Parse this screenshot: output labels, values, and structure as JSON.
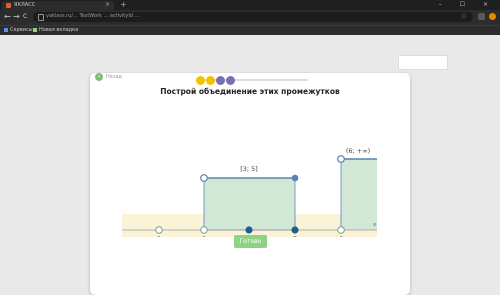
{
  "browser": {
    "tab_title": "ЯКЛАСС",
    "tab_close": "×",
    "new_tab": "+",
    "window_controls": "– ☐ ×",
    "back": "←",
    "forward": "→",
    "reload": "C",
    "url": "yaklass.ru/... TestWork ... activityId ...",
    "star_icon": "star-icon",
    "bookmarks": [
      {
        "label": "Сервисы",
        "icon": "grid-icon",
        "color": "#5b8def"
      },
      {
        "label": "Новая вкладка",
        "icon": "page-icon",
        "color": "#9bcf7e"
      }
    ]
  },
  "exercise": {
    "back_label": "Назад",
    "progress_dots": [
      "#f2c200",
      "#f2c200",
      "#7a6fb3",
      "#7a6fb3"
    ],
    "title": "Построй объединение этих промежутков",
    "interval_label_1": "[3; 5]",
    "interval_label_2": "(6; +∞)",
    "axis_var": "x",
    "ticks": [
      "2",
      "3",
      "4",
      "5",
      "6"
    ],
    "ready_button": "Готово"
  },
  "colors": {
    "accent_green": "#8ed383",
    "interval_fill": "#d3e7d6",
    "band": "#fbf3d8",
    "marker_blue": "#1f5f8a",
    "outline_blue": "#5784b0",
    "hollow_gray": "#6a9a84"
  }
}
